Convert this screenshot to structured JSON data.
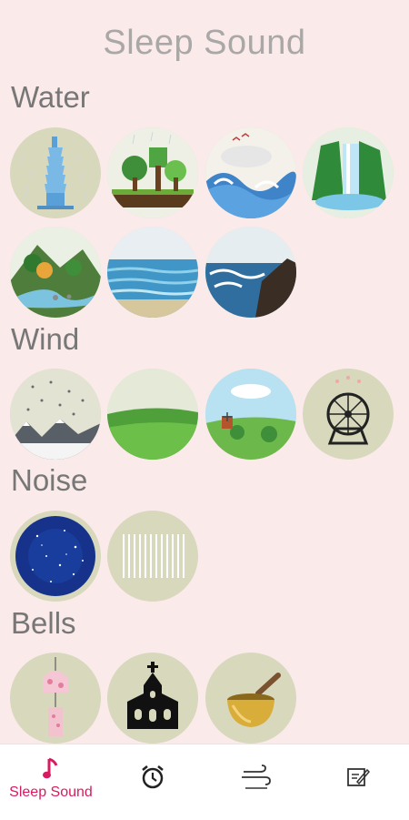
{
  "app": {
    "title": "Sleep Sound"
  },
  "sections": [
    {
      "title": "Water",
      "items": [
        {
          "icon": "tower-rain-icon"
        },
        {
          "icon": "forest-rain-icon"
        },
        {
          "icon": "ocean-waves-icon"
        },
        {
          "icon": "waterfall-icon"
        },
        {
          "icon": "river-stream-icon"
        },
        {
          "icon": "calm-sea-icon"
        },
        {
          "icon": "rocky-shore-icon"
        }
      ]
    },
    {
      "title": "Wind",
      "items": [
        {
          "icon": "snowy-mountain-icon"
        },
        {
          "icon": "grass-field-icon"
        },
        {
          "icon": "windmill-icon"
        },
        {
          "icon": "electric-fan-icon"
        }
      ]
    },
    {
      "title": "Noise",
      "items": [
        {
          "icon": "starry-sky-icon"
        },
        {
          "icon": "white-noise-icon"
        }
      ]
    },
    {
      "title": "Bells",
      "items": [
        {
          "icon": "wind-chime-icon"
        },
        {
          "icon": "church-bell-icon"
        },
        {
          "icon": "singing-bowl-icon"
        }
      ]
    }
  ],
  "nav": {
    "items": [
      {
        "icon": "music-note-icon",
        "label": "Sleep Sound",
        "active": true
      },
      {
        "icon": "alarm-clock-icon",
        "label": ""
      },
      {
        "icon": "breathing-icon",
        "label": ""
      },
      {
        "icon": "note-edit-icon",
        "label": ""
      }
    ]
  },
  "colors": {
    "accent": "#d81b60",
    "background": "#fbeaea",
    "tile": "#d8d8bd"
  }
}
